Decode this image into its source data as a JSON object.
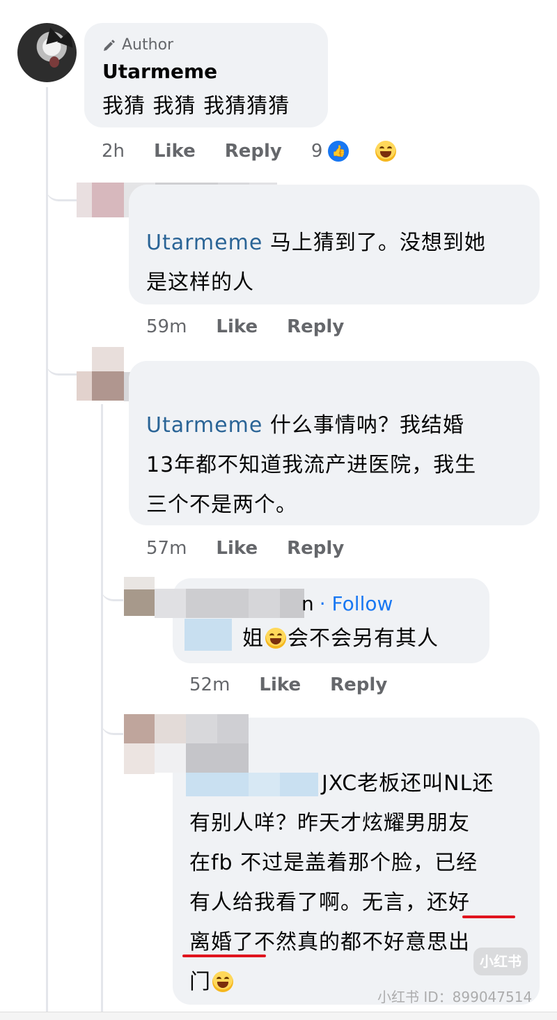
{
  "author_comment": {
    "tag": "Author",
    "name": "Utarmeme",
    "text": "我猜 我猜 我猜猜猜",
    "time": "2h",
    "like_label": "Like",
    "reply_label": "Reply",
    "reaction_count": "9"
  },
  "replies": [
    {
      "mention": "Utarmeme",
      "line1": " 马上猜到了。没想到她",
      "line2": "是这样的人",
      "time": "59m",
      "like_label": "Like",
      "reply_label": "Reply"
    },
    {
      "mention": "Utarmeme",
      "line1": " 什么事情呐？我结婚",
      "line2": "13年都不知道我流产进医院，我生",
      "line3": "三个不是两个。",
      "time": "57m",
      "like_label": "Like",
      "reply_label": "Reply"
    },
    {
      "name_suffix": "n",
      "follow_label": "· Follow",
      "text_a": "姐",
      "text_b": "会不会另有其人",
      "time": "52m",
      "like_label": "Like",
      "reply_label": "Reply"
    },
    {
      "line1": "JXC老板还叫NL还",
      "line2": "有别人咩？昨天才炫耀男朋友",
      "line3": "在fb 不过是盖着那个脸，已经",
      "line4a": "有人给我看了啊。无言，",
      "line4b": "还好",
      "line5a": "离婚了",
      "line5b": "不然真的都不好意思出",
      "line6": "门"
    }
  ],
  "watermark": {
    "logo": "小红书",
    "id_text": "小红书 ID：899047514"
  },
  "colors": {
    "bubble": "#f0f2f5",
    "mention": "#2a6496",
    "follow": "#1877f2",
    "underline": "#e0141e",
    "meta": "#65676b"
  }
}
